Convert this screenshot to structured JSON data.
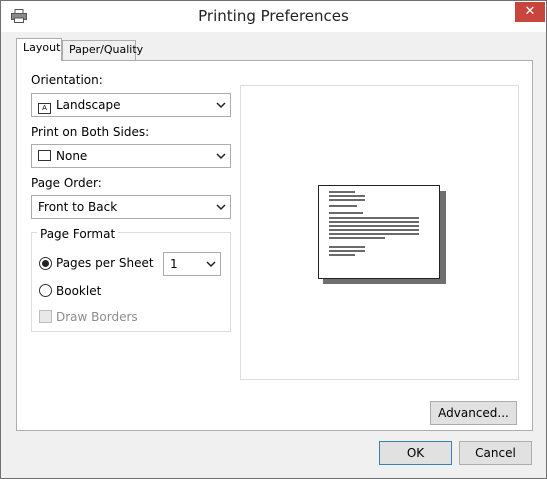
{
  "window": {
    "title": "Printing Preferences",
    "close_label": "✕"
  },
  "tabs": [
    {
      "label": "Layout",
      "active": true
    },
    {
      "label": "Paper/Quality",
      "active": false
    }
  ],
  "orientation": {
    "label": "Orientation:",
    "value": "Landscape",
    "icon": "landscape-icon",
    "icon_glyph": "A"
  },
  "both_sides": {
    "label": "Print on Both Sides:",
    "value": "None",
    "icon": "duplex-none-icon"
  },
  "page_order": {
    "label": "Page Order:",
    "value": "Front to Back"
  },
  "page_format": {
    "title": "Page Format",
    "pages_per_sheet_label": "Pages per Sheet",
    "pages_per_sheet_value": "1",
    "pages_per_sheet_selected": true,
    "booklet_label": "Booklet",
    "booklet_selected": false,
    "draw_borders_label": "Draw Borders",
    "draw_borders_checked": false,
    "draw_borders_enabled": false
  },
  "buttons": {
    "advanced": "Advanced...",
    "ok": "OK",
    "cancel": "Cancel"
  },
  "colors": {
    "close_button": "#c7453a",
    "window_bg": "#f0f0f0",
    "panel_bg": "#ffffff"
  }
}
